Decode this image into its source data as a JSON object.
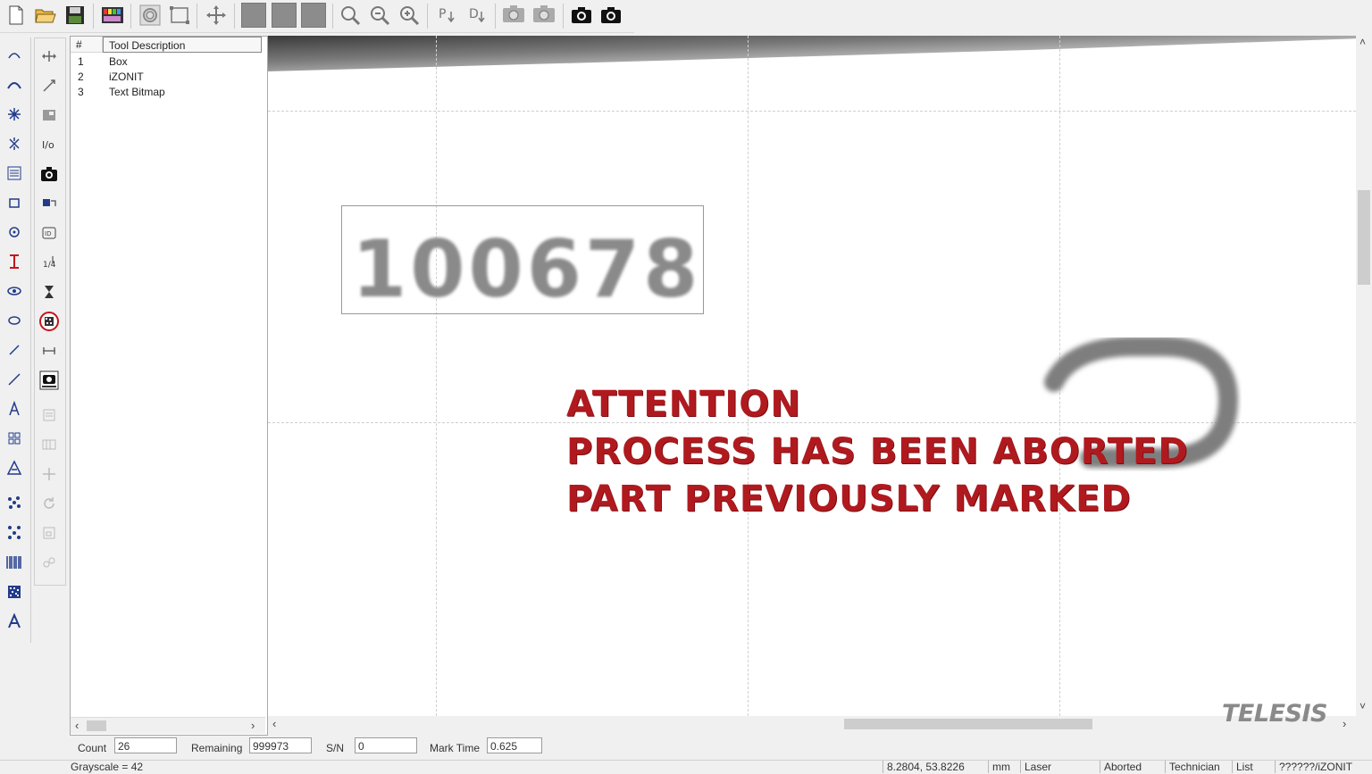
{
  "toolbar": {
    "buttons": [
      "new-file-icon",
      "open-folder-icon",
      "save-icon",
      "color-palette-icon",
      "ring-icon",
      "select-rect-icon",
      "move-icon",
      "gray-square-1-icon",
      "gray-square-2-icon",
      "gray-square-3-icon",
      "zoom-in-icon",
      "zoom-fit-icon",
      "zoom-out-icon",
      "p-down-icon",
      "d-down-icon",
      "camera-settings-icon",
      "camera-settings-2-icon",
      "camera-icon",
      "camera-2-icon"
    ]
  },
  "tool_list": {
    "headers": {
      "num": "#",
      "desc": "Tool Description"
    },
    "rows": [
      {
        "num": "1",
        "desc": "Box"
      },
      {
        "num": "2",
        "desc": "iZONIT"
      },
      {
        "num": "3",
        "desc": "Text Bitmap"
      }
    ]
  },
  "canvas": {
    "serial_text": "100678"
  },
  "overlay": {
    "line1": "ATTENTION",
    "line2": "PROCESS HAS BEEN ABORTED",
    "line3": "PART PREVIOUSLY MARKED"
  },
  "logo": "TELESIS",
  "fields": {
    "count_label": "Count",
    "count_value": "26",
    "remaining_label": "Remaining",
    "remaining_value": "999973",
    "sn_label": "S/N",
    "sn_value": "0",
    "marktime_label": "Mark Time",
    "marktime_value": "0.625"
  },
  "status": {
    "grayscale": "Grayscale = 42",
    "coords": "8.2804, 53.8226",
    "units": "mm",
    "device": "Laser",
    "state": "Aborted",
    "user": "Technician",
    "mode": "List",
    "pattern": "??????/iZONIT"
  },
  "colors": {
    "attention": "#b01a1f",
    "logo": "#8a8a8a"
  }
}
